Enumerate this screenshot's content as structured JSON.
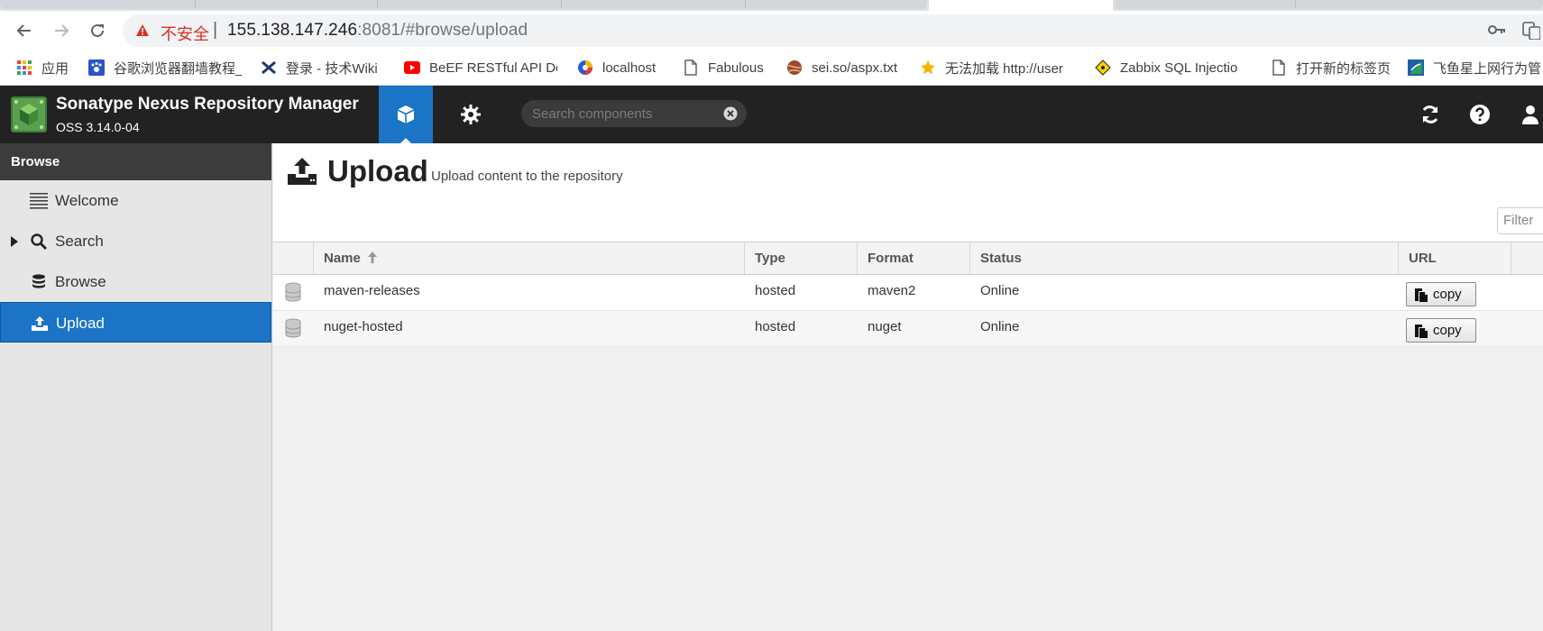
{
  "browser": {
    "insecure_label": "不安全",
    "url_host": "155.138.147.246",
    "url_rest": ":8081/#browse/upload",
    "bookmarks": [
      {
        "label": "应用",
        "icon": "apps-grid-icon"
      },
      {
        "label": "谷歌浏览器翻墙教程_",
        "icon": "paw-icon"
      },
      {
        "label": "登录 - 技术Wiki",
        "icon": "cross-logo-icon"
      },
      {
        "label": "BeEF RESTful API Do",
        "icon": "youtube-icon"
      },
      {
        "label": "localhost",
        "icon": "colorful-logo-icon"
      },
      {
        "label": "Fabulous",
        "icon": "page-icon"
      },
      {
        "label": "sei.so/aspx.txt",
        "icon": "ball-icon"
      },
      {
        "label": "无法加载 http://user",
        "icon": "star-icon"
      },
      {
        "label": "Zabbix SQL Injectio",
        "icon": "diamond-icon"
      },
      {
        "label": "打开新的标签页",
        "icon": "page-icon"
      },
      {
        "label": "飞鱼星上网行为管",
        "icon": "flag-icon"
      }
    ]
  },
  "header": {
    "app_title": "Sonatype Nexus Repository Manager",
    "version": "OSS 3.14.0-04",
    "search_placeholder": "Search components"
  },
  "sidebar": {
    "heading": "Browse",
    "items": [
      {
        "label": "Welcome",
        "icon": "list-icon"
      },
      {
        "label": "Search",
        "icon": "search-icon"
      },
      {
        "label": "Browse",
        "icon": "database-icon"
      },
      {
        "label": "Upload",
        "icon": "upload-icon",
        "selected": true
      }
    ]
  },
  "main": {
    "title": "Upload",
    "subtitle": "Upload content to the repository",
    "filter_placeholder": "Filter",
    "columns": [
      "Name",
      "Type",
      "Format",
      "Status",
      "URL"
    ],
    "rows": [
      {
        "name": "maven-releases",
        "type": "hosted",
        "format": "maven2",
        "status": "Online",
        "url_button": "copy"
      },
      {
        "name": "nuget-hosted",
        "type": "hosted",
        "format": "nuget",
        "status": "Online",
        "url_button": "copy"
      }
    ]
  },
  "colors": {
    "header_bg": "#222222",
    "accent_blue": "#1b74c5",
    "sidebar_bg": "#e6e6e6"
  }
}
